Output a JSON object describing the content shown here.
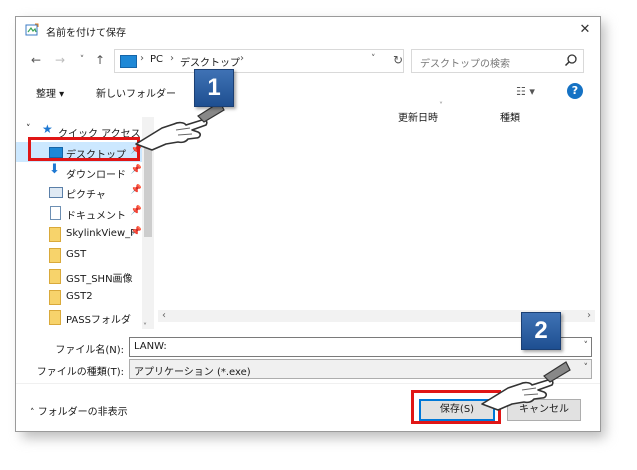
{
  "window": {
    "title": "名前を付けて保存",
    "close": "✕"
  },
  "nav": {
    "back": "←",
    "forward": "→",
    "recent": "˅",
    "up": "↑",
    "breadcrumb": [
      "PC",
      "デスクトップ"
    ],
    "refresh": "↻",
    "search_placeholder": "デスクトップの検索"
  },
  "toolbar": {
    "organize": "整理 ▾",
    "new_folder": "新しいフォルダー",
    "view": "☷ ▾",
    "help": "?"
  },
  "sidebar": {
    "quick_access": "クイック アクセス",
    "items": [
      {
        "label": "デスクトップ",
        "pinned": true,
        "selected": true
      },
      {
        "label": "ダウンロード",
        "pinned": true
      },
      {
        "label": "ピクチャ",
        "pinned": true
      },
      {
        "label": "ドキュメント",
        "pinned": true
      },
      {
        "label": "SkylinkView_F",
        "pinned": true
      },
      {
        "label": "GST"
      },
      {
        "label": "GST_SHN画像"
      },
      {
        "label": "GST2"
      },
      {
        "label": "PASSフォルダ"
      }
    ]
  },
  "content": {
    "columns": [
      "更新日時",
      "種類"
    ]
  },
  "form": {
    "filename_label": "ファイル名(N):",
    "filename_value": "LANW:",
    "filetype_label": "ファイルの種類(T):",
    "filetype_value": "アプリケーション (*.exe)"
  },
  "footer": {
    "hide_folders": "フォルダーの非表示",
    "save": "保存(S)",
    "cancel": "キャンセル"
  },
  "annotations": {
    "step1": "1",
    "step2": "2"
  },
  "colors": {
    "accent": "#0078d7",
    "highlight": "#e01616",
    "badge": "#2f5f9e",
    "selected": "#cce8ff"
  }
}
